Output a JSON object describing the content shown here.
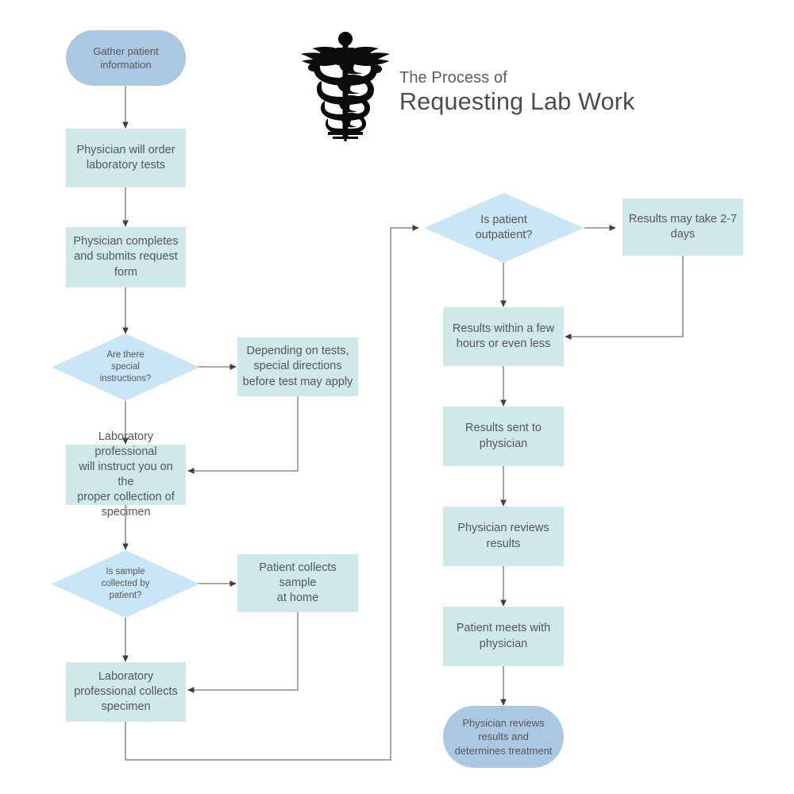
{
  "header": {
    "logo_icon": "caduceus-icon",
    "title_line1": "The Process of",
    "title_line2": "Requesting Lab Work"
  },
  "colors": {
    "process_fill": "#cfe8e8",
    "decision_fill": "#c9e6f6",
    "terminal_fill": "#aac8e2",
    "text": "#555759",
    "connector": "#8a8a8a",
    "arrowhead": "#3f3f3f",
    "background": "#ffffff"
  },
  "chart_data": {
    "type": "diagram",
    "diagram_type": "flowchart",
    "title": "The Process of Requesting Lab Work",
    "nodes": [
      {
        "id": "n1",
        "shape": "terminal",
        "label": "Gather patient\ninformation"
      },
      {
        "id": "n2",
        "shape": "process",
        "label": "Physician will order\nlaboratory tests"
      },
      {
        "id": "n3",
        "shape": "process",
        "label": "Physician completes\nand submits request\nform"
      },
      {
        "id": "n4",
        "shape": "decision",
        "label": "Are there\nspecial\ninstructions?"
      },
      {
        "id": "n5",
        "shape": "process",
        "label": "Depending on tests,\nspecial directions\nbefore test may apply"
      },
      {
        "id": "n6",
        "shape": "process",
        "label": "Laboratory professional\nwill instruct you on the\nproper collection of\nspecimen"
      },
      {
        "id": "n7",
        "shape": "decision",
        "label": "Is sample\ncollected by\npatient?"
      },
      {
        "id": "n8",
        "shape": "process",
        "label": "Patient collects sample\nat home"
      },
      {
        "id": "n9",
        "shape": "process",
        "label": "Laboratory\nprofessional collects\nspecimen"
      },
      {
        "id": "n10",
        "shape": "decision",
        "label": "Is patient\noutpatient?"
      },
      {
        "id": "n11",
        "shape": "process",
        "label": "Results may take 2-7\ndays"
      },
      {
        "id": "n12",
        "shape": "process",
        "label": "Results within a few\nhours or even less"
      },
      {
        "id": "n13",
        "shape": "process",
        "label": "Results sent to\nphysician"
      },
      {
        "id": "n14",
        "shape": "process",
        "label": "Physician reviews\nresults"
      },
      {
        "id": "n15",
        "shape": "process",
        "label": "Patient meets with\nphysician"
      },
      {
        "id": "n16",
        "shape": "terminal",
        "label": "Physician reviews\nresults and\ndetermines treatment"
      }
    ],
    "edges": [
      {
        "from": "n1",
        "to": "n2"
      },
      {
        "from": "n2",
        "to": "n3"
      },
      {
        "from": "n3",
        "to": "n4"
      },
      {
        "from": "n4",
        "to": "n5"
      },
      {
        "from": "n4",
        "to": "n6"
      },
      {
        "from": "n5",
        "to": "n6"
      },
      {
        "from": "n6",
        "to": "n7"
      },
      {
        "from": "n7",
        "to": "n8"
      },
      {
        "from": "n7",
        "to": "n9"
      },
      {
        "from": "n8",
        "to": "n9"
      },
      {
        "from": "n9",
        "to": "n10"
      },
      {
        "from": "n10",
        "to": "n11"
      },
      {
        "from": "n10",
        "to": "n12"
      },
      {
        "from": "n11",
        "to": "n12"
      },
      {
        "from": "n12",
        "to": "n13"
      },
      {
        "from": "n13",
        "to": "n14"
      },
      {
        "from": "n14",
        "to": "n15"
      },
      {
        "from": "n15",
        "to": "n16"
      }
    ]
  }
}
